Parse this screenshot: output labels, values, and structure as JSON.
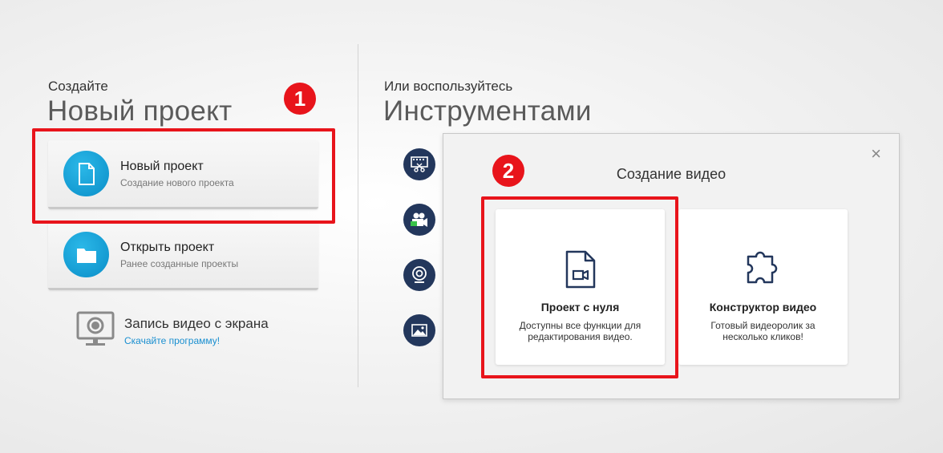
{
  "left": {
    "subtitle": "Создайте",
    "title": "Новый проект",
    "cards": [
      {
        "title": "Новый проект",
        "subtitle": "Создание нового проекта",
        "icon": "document-icon"
      },
      {
        "title": "Открыть проект",
        "subtitle": "Ранее созданные проекты",
        "icon": "folder-icon"
      }
    ],
    "record": {
      "title": "Запись видео с экрана",
      "link": "Скачайте программу!",
      "icon": "monitor-record-icon"
    }
  },
  "right": {
    "subtitle": "Или воспользуйтесь",
    "title": "Инструментами",
    "tools": [
      "film-cut-icon",
      "camera-record-icon",
      "webcam-icon",
      "image-icon"
    ]
  },
  "dialog": {
    "title": "Создание видео",
    "close": "×",
    "options": [
      {
        "title": "Проект с нуля",
        "description": "Доступны все функции для редактирования видео.",
        "icon": "video-file-icon"
      },
      {
        "title": "Конструктор видео",
        "description": "Готовый видеоролик за несколько кликов!",
        "icon": "puzzle-icon"
      }
    ]
  },
  "annotations": {
    "badge1": "1",
    "badge2": "2"
  },
  "colors": {
    "accent_blue": "#0a8ec8",
    "highlight_red": "#e8141b",
    "tool_navy": "#23375c",
    "link_blue": "#1a8fd0"
  }
}
